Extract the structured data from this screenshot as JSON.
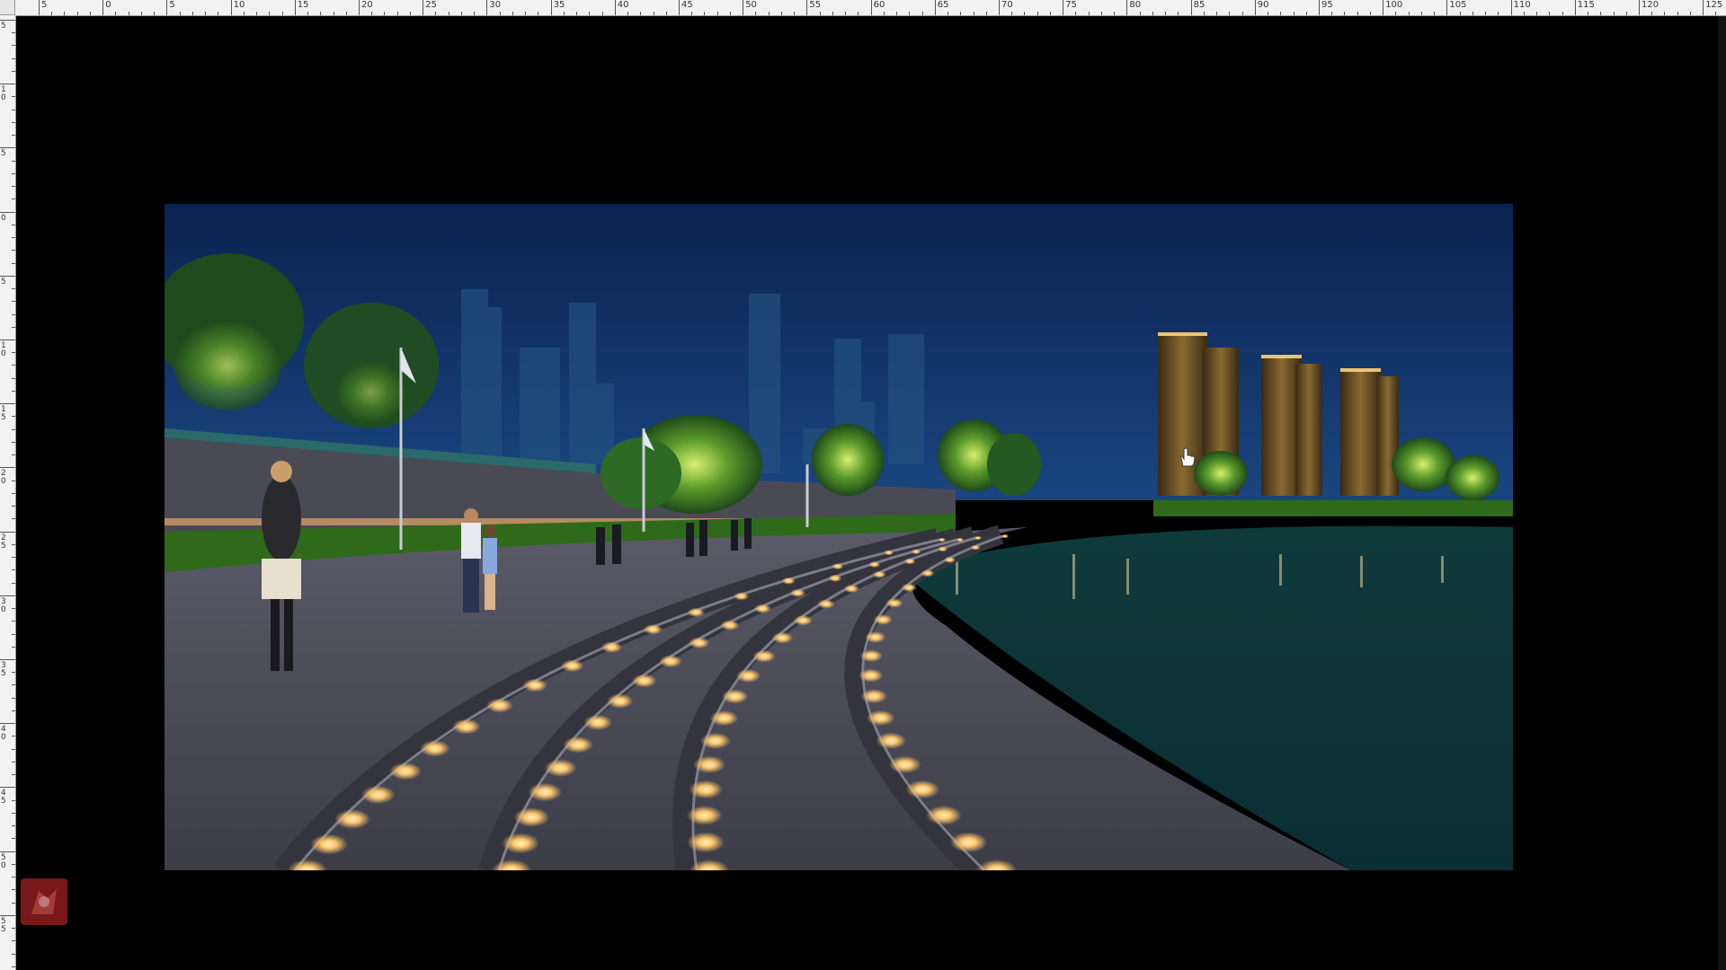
{
  "window": {
    "app": "image-editor"
  },
  "ruler_top": {
    "labels": [
      "5",
      "0",
      "5",
      "10",
      "15",
      "20",
      "25",
      "30",
      "35",
      "40",
      "45",
      "50",
      "55",
      "60",
      "65",
      "70",
      "75",
      "80",
      "85",
      "90",
      "95",
      "100",
      "105",
      "110",
      "115",
      "120",
      "125"
    ]
  },
  "ruler_left": {
    "labels": [
      "5",
      "10",
      "5",
      "0",
      "5",
      "10",
      "15",
      "20",
      "25",
      "30",
      "35",
      "40",
      "45",
      "50",
      "55"
    ]
  },
  "document": {
    "content": "night-rendering"
  },
  "colors": {
    "ruler_bg": "#f2f2f2",
    "canvas_bg": "#000000",
    "sky_top": "#0b2552",
    "sky_bottom": "#17427a",
    "water": "#0d3c3e",
    "light_glow": "#ffcc77",
    "tree_green": "#7fd23a",
    "badge": "#8e1d1d"
  },
  "icons": {
    "cursor": "hand-cursor-icon",
    "badge": "app-badge-icon"
  }
}
